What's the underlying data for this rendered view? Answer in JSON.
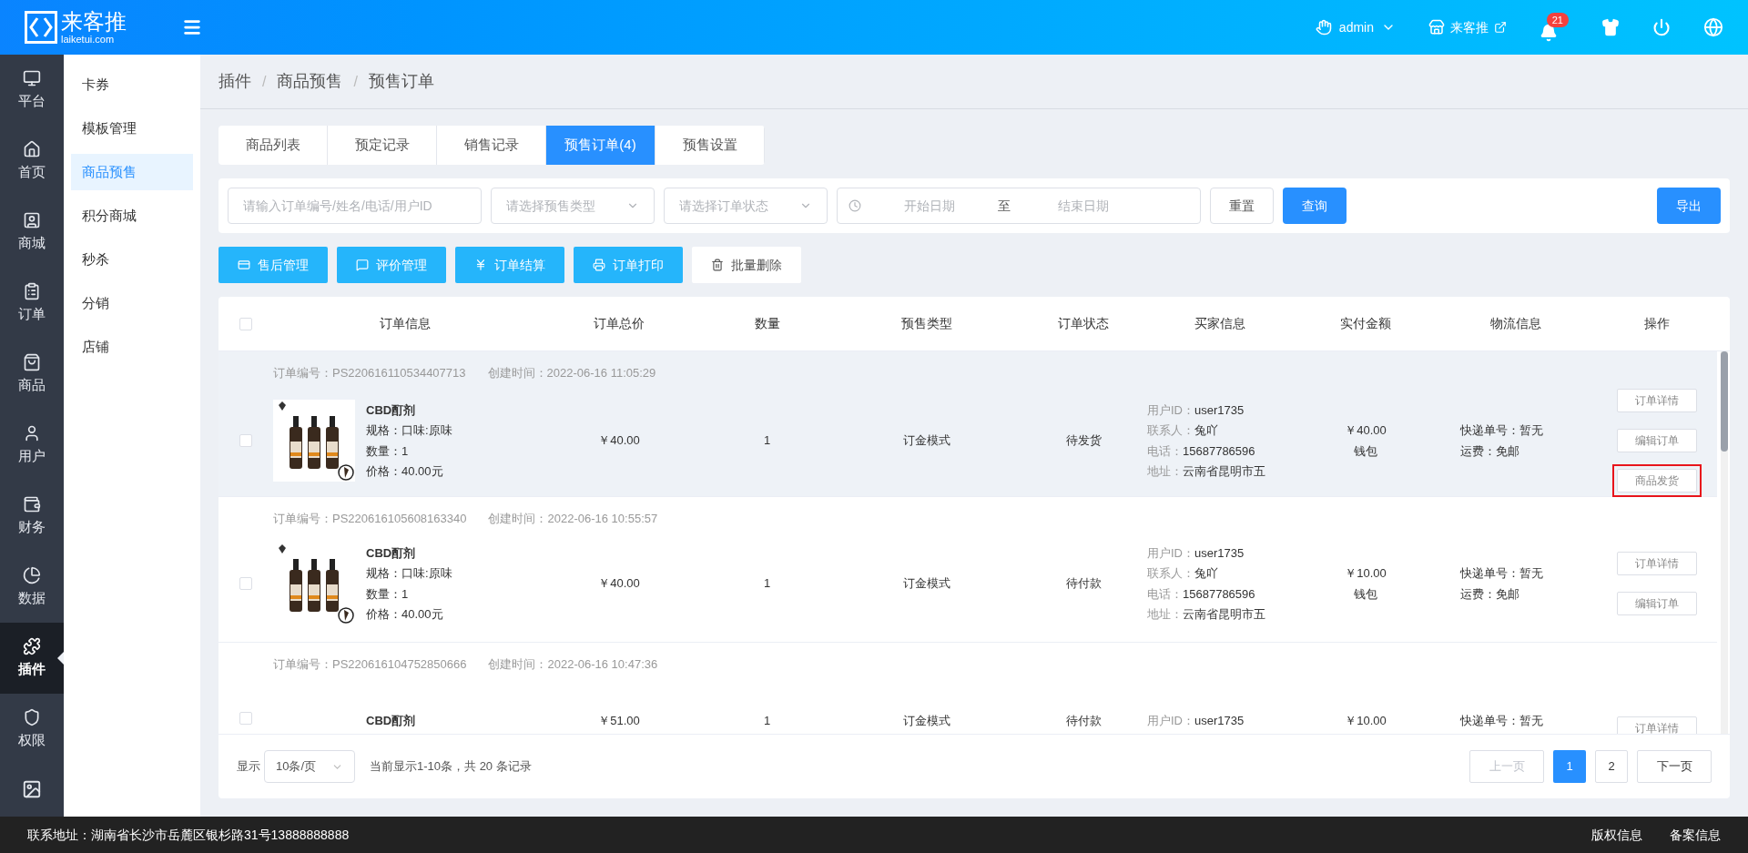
{
  "header": {
    "logo_name": "来客推",
    "logo_domain": "laiketui.com",
    "user": "admin",
    "store": "来客推",
    "notifications": "21"
  },
  "rail": [
    {
      "label": "平台",
      "selected": false
    },
    {
      "label": "首页",
      "selected": false
    },
    {
      "label": "商城",
      "selected": false
    },
    {
      "label": "订单",
      "selected": false
    },
    {
      "label": "商品",
      "selected": false
    },
    {
      "label": "用户",
      "selected": false
    },
    {
      "label": "财务",
      "selected": false
    },
    {
      "label": "数据",
      "selected": false
    },
    {
      "label": "插件",
      "selected": true
    },
    {
      "label": "权限",
      "selected": false
    }
  ],
  "submenu": [
    {
      "label": "卡券",
      "selected": false
    },
    {
      "label": "模板管理",
      "selected": false
    },
    {
      "label": "商品预售",
      "selected": true
    },
    {
      "label": "积分商城",
      "selected": false
    },
    {
      "label": "秒杀",
      "selected": false
    },
    {
      "label": "分销",
      "selected": false
    },
    {
      "label": "店铺",
      "selected": false
    }
  ],
  "breadcrumb": {
    "items": [
      "插件",
      "商品预售",
      "预售订单"
    ],
    "separator": "/"
  },
  "tabs": [
    {
      "label": "商品列表",
      "selected": false
    },
    {
      "label": "预定记录",
      "selected": false
    },
    {
      "label": "销售记录",
      "selected": false
    },
    {
      "label": "预售订单(4)",
      "selected": true
    },
    {
      "label": "预售设置",
      "selected": false
    }
  ],
  "filters": {
    "search_placeholder": "请输入订单编号/姓名/电话/用户ID",
    "type_placeholder": "请选择预售类型",
    "status_placeholder": "请选择订单状态",
    "start_placeholder": "开始日期",
    "range_separator": "至",
    "end_placeholder": "结束日期",
    "reset": "重置",
    "query": "查询",
    "export": "导出"
  },
  "actions": [
    {
      "label": "售后管理",
      "kind": "primary"
    },
    {
      "label": "评价管理",
      "kind": "primary"
    },
    {
      "label": "订单结算",
      "kind": "primary"
    },
    {
      "label": "订单打印",
      "kind": "primary"
    },
    {
      "label": "批量删除",
      "kind": "plain"
    }
  ],
  "table": {
    "select_all_checked": false,
    "columns": [
      "订单信息",
      "订单总价",
      "数量",
      "预售类型",
      "订单状态",
      "买家信息",
      "实付金额",
      "物流信息",
      "操作"
    ],
    "rows": [
      {
        "checked": false,
        "highlighted": true,
        "order_no": "订单编号：PS220616110534407713",
        "created": "创建时间：2022-06-16 11:05:29",
        "product": {
          "name": "CBD酊剂",
          "details": [
            "规格：口味:原味",
            "数量：1",
            "价格：40.00元"
          ]
        },
        "total": "￥40.00",
        "quantity": "1",
        "presale_type": "订金模式",
        "status": "待发货",
        "buyer": [
          {
            "label": "用户ID：",
            "value": "user1735"
          },
          {
            "label": "联系人：",
            "value": "兔吖"
          },
          {
            "label": "电话：",
            "value": "15687786596"
          },
          {
            "label": "地址：",
            "value": "云南省昆明市五"
          }
        ],
        "paid": [
          "￥40.00",
          "钱包"
        ],
        "logistics": [
          "快递单号：暂无",
          "运费：免邮"
        ],
        "operations": [
          {
            "label": "订单详情",
            "marked": false
          },
          {
            "label": "编辑订单",
            "marked": false
          },
          {
            "label": "商品发货",
            "marked": true
          }
        ]
      },
      {
        "checked": false,
        "highlighted": false,
        "order_no": "订单编号：PS220616105608163340",
        "created": "创建时间：2022-06-16 10:55:57",
        "product": {
          "name": "CBD酊剂",
          "details": [
            "规格：口味:原味",
            "数量：1",
            "价格：40.00元"
          ]
        },
        "total": "￥40.00",
        "quantity": "1",
        "presale_type": "订金模式",
        "status": "待付款",
        "buyer": [
          {
            "label": "用户ID：",
            "value": "user1735"
          },
          {
            "label": "联系人：",
            "value": "兔吖"
          },
          {
            "label": "电话：",
            "value": "15687786596"
          },
          {
            "label": "地址：",
            "value": "云南省昆明市五"
          }
        ],
        "paid": [
          "￥10.00",
          "钱包"
        ],
        "logistics": [
          "快递单号：暂无",
          "运费：免邮"
        ],
        "operations": [
          {
            "label": "订单详情",
            "marked": false
          },
          {
            "label": "编辑订单",
            "marked": false
          }
        ]
      },
      {
        "checked": false,
        "highlighted": false,
        "order_no": "订单编号：PS220616104752850666",
        "created": "创建时间：2022-06-16 10:47:36",
        "product": {
          "name": "CBD酊剂"
        },
        "total": "￥51.00",
        "quantity": "1",
        "presale_type": "订金模式",
        "status": "待付款",
        "buyer": [
          {
            "label": "用户ID：",
            "value": "user1735"
          }
        ],
        "paid": [
          "￥10.00"
        ],
        "logistics": [
          "快递单号：暂无"
        ],
        "operations": [
          {
            "label": "订单详情",
            "marked": false
          }
        ]
      }
    ]
  },
  "pagination": {
    "show_label": "显示",
    "page_size": "10条/页",
    "summary": "当前显示1-10条，共 20 条记录",
    "prev": {
      "label": "上一页",
      "disabled": true
    },
    "pages": [
      {
        "label": "1",
        "selected": true
      },
      {
        "label": "2",
        "selected": false
      }
    ],
    "next": {
      "label": "下一页",
      "disabled": false
    }
  },
  "footer": {
    "address": "联系地址：湖南省长沙市岳麓区银杉路31号13888888888",
    "links": [
      "版权信息",
      "备案信息"
    ]
  }
}
